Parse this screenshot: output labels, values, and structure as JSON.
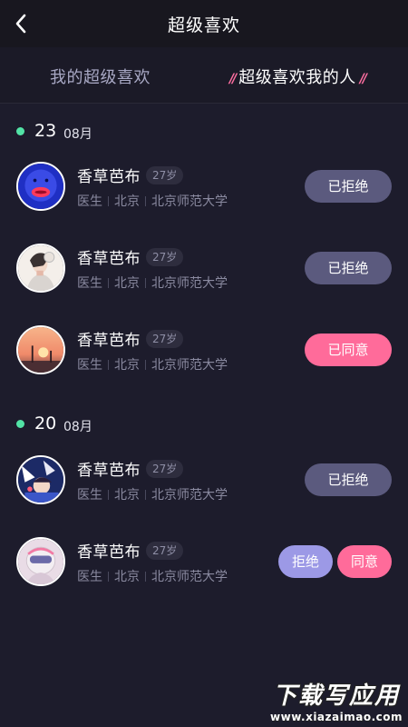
{
  "header": {
    "title": "超级喜欢",
    "back_icon": "chevron-left-icon"
  },
  "tabs": [
    {
      "label": "我的超级喜欢",
      "active": false
    },
    {
      "label": "超级喜欢我的人",
      "active": true
    }
  ],
  "sections": [
    {
      "day": "23",
      "month": "08月",
      "items": [
        {
          "name": "香草芭布",
          "age": "27岁",
          "job": "医生",
          "city": "北京",
          "school": "北京师范大学",
          "button": "已拒绝"
        },
        {
          "name": "香草芭布",
          "age": "27岁",
          "job": "医生",
          "city": "北京",
          "school": "北京师范大学",
          "button": "已拒绝"
        },
        {
          "name": "香草芭布",
          "age": "27岁",
          "job": "医生",
          "city": "北京",
          "school": "北京师范大学",
          "button": "已同意"
        }
      ]
    },
    {
      "day": "20",
      "month": "08月",
      "items": [
        {
          "name": "香草芭布",
          "age": "27岁",
          "job": "医生",
          "city": "北京",
          "school": "北京师范大学",
          "button": "已拒绝"
        },
        {
          "name": "香草芭布",
          "age": "27岁",
          "job": "医生",
          "city": "北京",
          "school": "北京师范大学",
          "reject": "拒绝",
          "accept": "同意"
        }
      ]
    }
  ],
  "watermark": {
    "main": "下载写应用",
    "sub": "www.xiazaimao.com"
  },
  "colors": {
    "background": "#1d1c2c",
    "accent_pink": "#ff6b9a",
    "rejected_gray": "#5b5a7e",
    "reject_lavender": "#9c99e6",
    "date_dot": "#52e3a6"
  }
}
